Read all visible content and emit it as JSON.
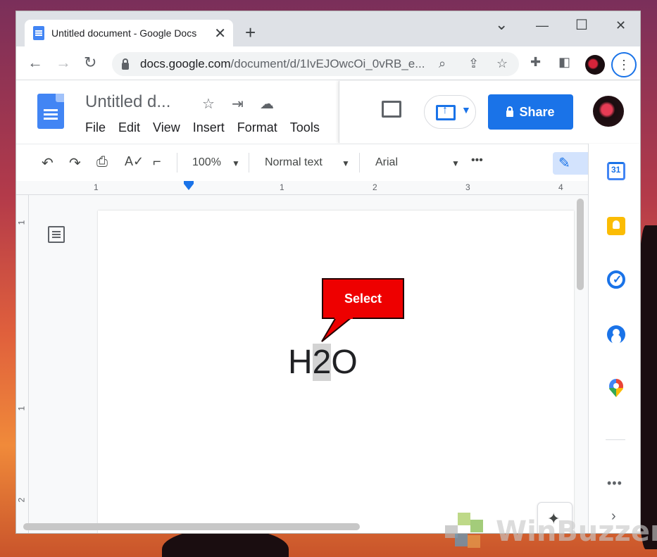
{
  "browser": {
    "tab_title": "Untitled document - Google Docs",
    "tab_close": "✕",
    "new_tab": "+",
    "url_main": "docs.google.com",
    "url_rest": "/document/d/1IvEJOwcOi_0vRB_e...",
    "window_controls": {
      "minimize": "—",
      "maximize": "☐",
      "close": "✕",
      "dropdown": "⌄"
    }
  },
  "docs": {
    "title": "Untitled d...",
    "menu": [
      "File",
      "Edit",
      "View",
      "Insert",
      "Format",
      "Tools"
    ],
    "share_label": "Share"
  },
  "format_toolbar": {
    "zoom": "100%",
    "style": "Normal text",
    "font": "Arial",
    "more": "•••"
  },
  "ruler": {
    "horizontal": [
      "1",
      "1",
      "2",
      "3",
      "4"
    ],
    "vertical": [
      "1",
      "1",
      "2"
    ]
  },
  "document": {
    "before": "H",
    "selected": "2",
    "after": "O"
  },
  "callout": {
    "label": "Select"
  },
  "side_panel": {
    "items": [
      "calendar-icon",
      "keep-icon",
      "tasks-icon",
      "contacts-icon",
      "maps-icon"
    ],
    "more": "•••",
    "expand": "›"
  },
  "watermark": {
    "text": "WinBuzzer"
  },
  "colors": {
    "accent": "#1a73e8",
    "callout": "#ee0000",
    "selection": "#d3d3d3"
  }
}
